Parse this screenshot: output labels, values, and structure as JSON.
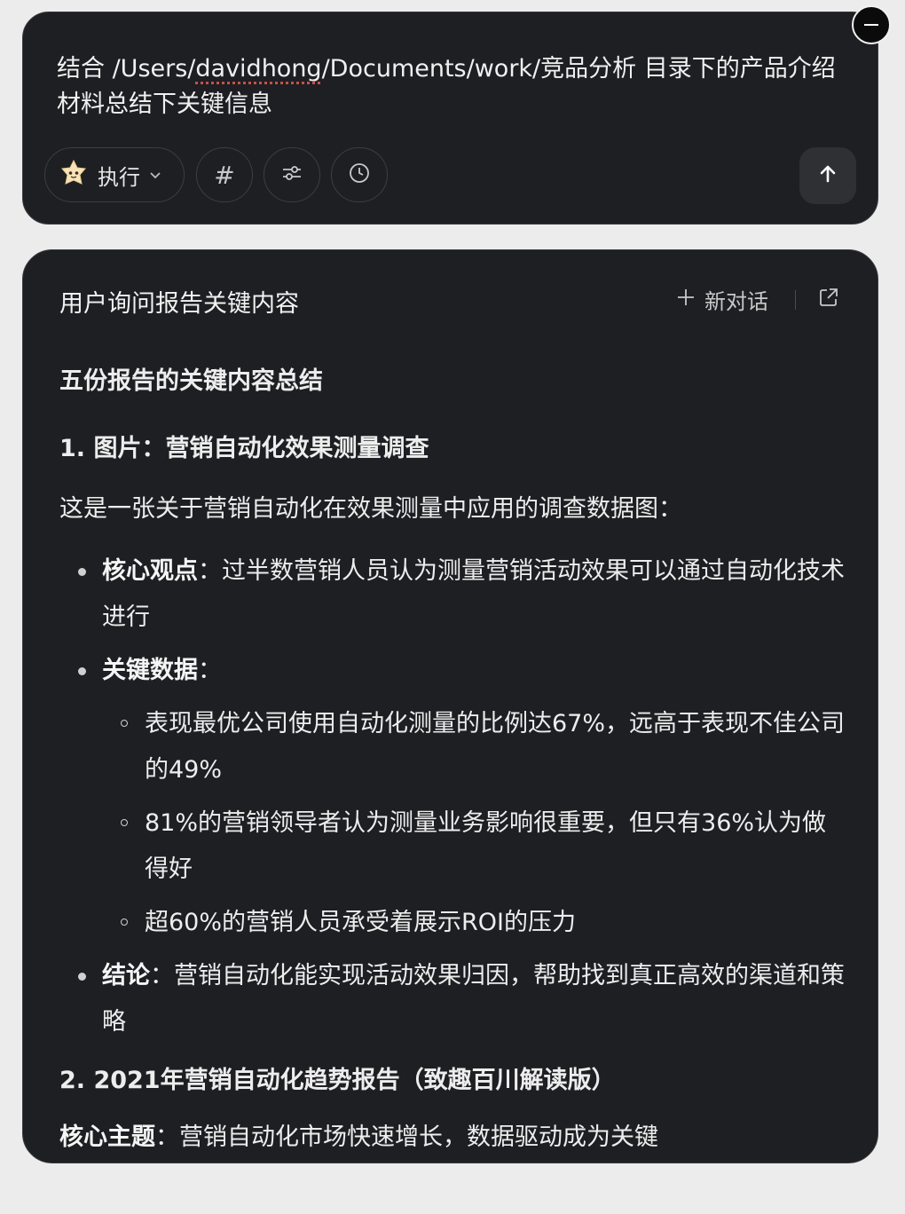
{
  "composer": {
    "prompt_part1": "结合 /Users/",
    "prompt_squiggle": "davidhong",
    "prompt_part2": "/Documents/work/竞品分析 目录下的产品介绍材料总结下关键信息",
    "mode_label": "执行",
    "hash_label": "#",
    "icons": {
      "mode": "star-face-icon",
      "chevron": "chevron-down-icon",
      "filter": "sliders-icon",
      "history": "clock-icon",
      "send": "arrow-up-icon",
      "collapse": "minus-icon"
    }
  },
  "chat": {
    "title": "用户询问报告关键内容",
    "new_chat_label": "新对话",
    "heading": "五份报告的关键内容总结",
    "section1": {
      "title": "1. 图片：营销自动化效果测量调查",
      "intro": "这是一张关于营销自动化在效果测量中应用的调查数据图：",
      "core_label": "核心观点",
      "core_text": "：过半数营销人员认为测量营销活动效果可以通过自动化技术进行",
      "data_label": "关键数据",
      "data_colon": "：",
      "data_points": [
        "表现最优公司使用自动化测量的比例达67%，远高于表现不佳公司的49%",
        "81%的营销领导者认为测量业务影响很重要，但只有36%认为做得好",
        "超60%的营销人员承受着展示ROI的压力"
      ],
      "conclusion_label": "结论",
      "conclusion_text": "：营销自动化能实现活动效果归因，帮助找到真正高效的渠道和策略"
    },
    "section2": {
      "title": "2. 2021年营销自动化趋势报告（致趣百川解读版）",
      "theme_label": "核心主题",
      "theme_text": "：营销自动化市场快速增长，数据驱动成为关键"
    }
  },
  "colors": {
    "background": "#ececec",
    "panel": "#1e1f22",
    "text": "#ededed",
    "squiggle": "#d9534f"
  }
}
